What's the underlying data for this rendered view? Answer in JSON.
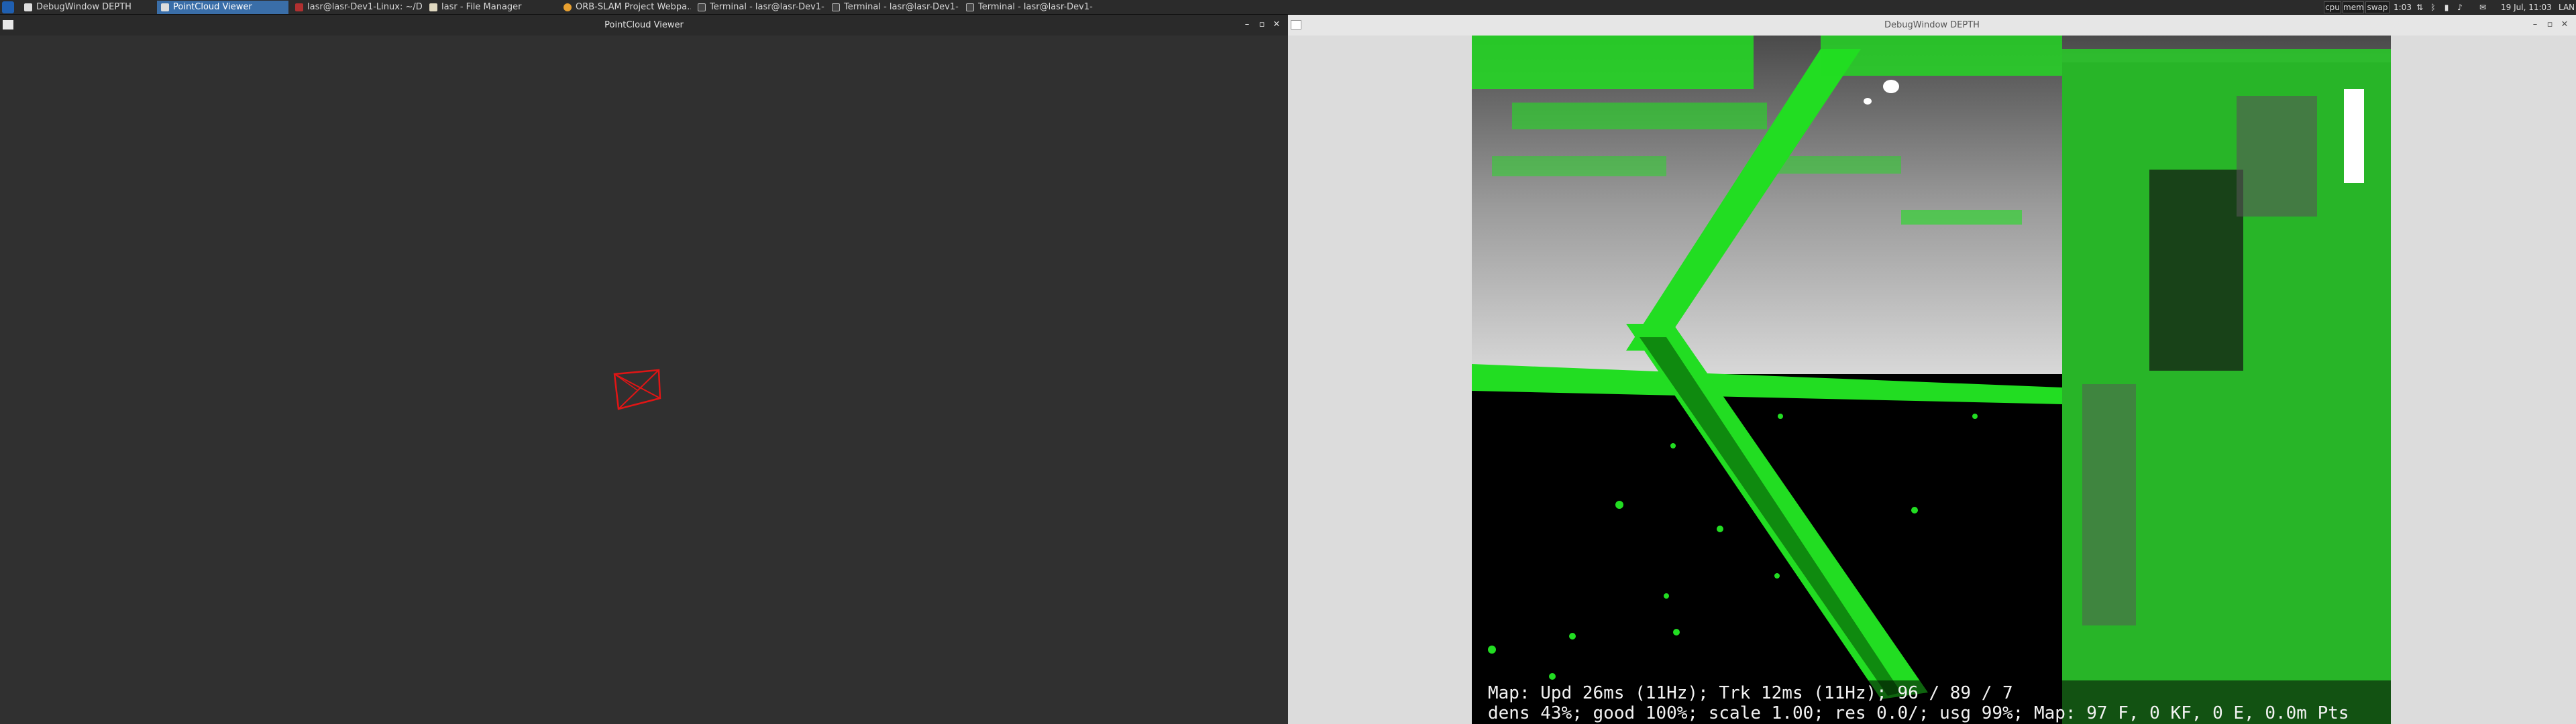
{
  "taskbar": {
    "tasks": [
      {
        "label": "DebugWindow DEPTH",
        "active": false
      },
      {
        "label": "PointCloud Viewer",
        "active": true
      },
      {
        "label": "lasr@lasr-Dev1-Linux: ~/D...",
        "active": false
      },
      {
        "label": "lasr - File Manager",
        "active": false
      },
      {
        "label": "ORB-SLAM Project Webpa...",
        "active": false
      },
      {
        "label": "Terminal - lasr@lasr-Dev1-L...",
        "active": false
      },
      {
        "label": "Terminal - lasr@lasr-Dev1-L...",
        "active": false
      },
      {
        "label": "Terminal - lasr@lasr-Dev1-L...",
        "active": false
      }
    ],
    "tray": {
      "cpu": "cpu",
      "mem": "mem",
      "swap": "swap",
      "uptime": "1:03",
      "clock": "19 Jul, 11:03",
      "layout": "LAN"
    }
  },
  "windows": {
    "pointcloud": {
      "title": "PointCloud Viewer",
      "frustum_color": "#e01515"
    },
    "debug": {
      "title": "DebugWindow DEPTH",
      "overlay_color": "#22dd22",
      "status_line1": "Map: Upd  26ms (11Hz); Trk  12ms (11Hz); 96 / 89 / 7",
      "status_line2": "dens 43%; good 100%; scale 1.00; res 0.0/; usg 99%; Map: 97 F, 0 KF, 0 E, 0.0m Pts"
    }
  }
}
